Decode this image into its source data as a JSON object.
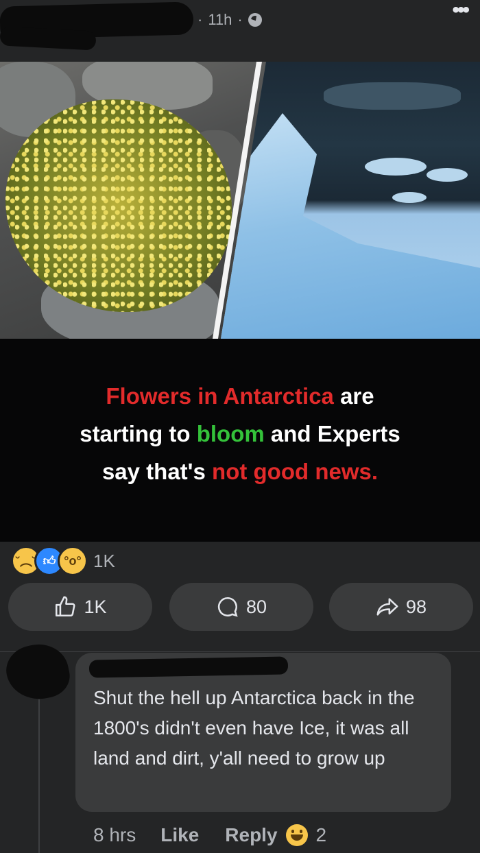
{
  "post": {
    "time": "11h",
    "separator": "·",
    "image": {
      "headline_part1": "Flowers in Antarctica",
      "headline_part2": " are",
      "headline_part3": "starting to ",
      "headline_part4": "bloom",
      "headline_part5": " and Experts",
      "headline_part6": "say that's ",
      "headline_part7": "not good news."
    },
    "reactions": {
      "types": [
        "sad",
        "like",
        "wow"
      ],
      "count": "1K"
    },
    "actions": {
      "like_count": "1K",
      "comment_count": "80",
      "share_count": "98"
    }
  },
  "comment": {
    "text": "Shut the hell up Antarctica back in the 1800's didn't even have Ice, it was all land and dirt, y'all need to grow up",
    "time": "8 hrs",
    "like_label": "Like",
    "reply_label": "Reply",
    "reaction_count": "2",
    "reaction_type": "haha"
  },
  "colors": {
    "background": "#242526",
    "bubble": "#3a3b3c",
    "headline_red": "#e22b2b",
    "headline_green": "#34c23a",
    "like_blue": "#2d88ff"
  }
}
